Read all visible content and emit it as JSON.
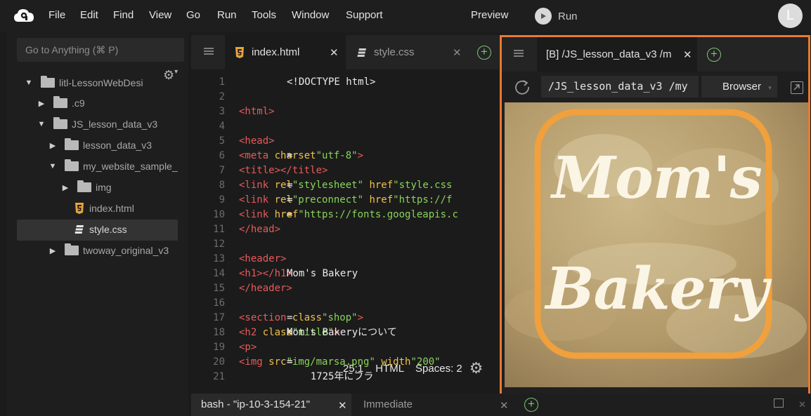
{
  "menubar": {
    "logo_icon": "cloud9-logo-icon",
    "items": [
      "File",
      "Edit",
      "Find",
      "View",
      "Go",
      "Run",
      "Tools",
      "Window",
      "Support"
    ],
    "preview_label": "Preview",
    "run_label": "Run",
    "avatar_initial": "L"
  },
  "sidebar": {
    "goto_placeholder": "Go to Anything (⌘ P)",
    "tree": [
      {
        "label": "litl-LessonWebDesi",
        "type": "folder",
        "expanded": true
      },
      {
        "label": ".c9",
        "type": "folder",
        "expanded": false
      },
      {
        "label": "JS_lesson_data_v3",
        "type": "folder",
        "expanded": true
      },
      {
        "label": "lesson_data_v3",
        "type": "folder",
        "expanded": false
      },
      {
        "label": "my_website_sample_",
        "type": "folder",
        "expanded": true
      },
      {
        "label": "img",
        "type": "folder",
        "expanded": false
      },
      {
        "label": "index.html",
        "type": "html-file"
      },
      {
        "label": "style.css",
        "type": "css-file",
        "selected": true
      },
      {
        "label": "twoway_original_v3",
        "type": "folder",
        "expanded": false
      }
    ]
  },
  "editor": {
    "tabs": [
      {
        "label": "index.html",
        "icon": "html5-icon",
        "active": true
      },
      {
        "label": "style.css",
        "icon": "css3-icon",
        "active": false
      }
    ],
    "lines": [
      [
        {
          "c": "txt",
          "t": "<!DOCTYPE html>"
        }
      ],
      [],
      [
        {
          "c": "tg",
          "t": "<html>"
        }
      ],
      [],
      [
        {
          "c": "tg",
          "t": "<head>"
        }
      ],
      [
        {
          "c": "txt",
          "t": "  "
        },
        {
          "c": "tg",
          "t": "<meta "
        },
        {
          "c": "at",
          "t": "charset"
        },
        {
          "c": "txt",
          "t": "="
        },
        {
          "c": "st",
          "t": "\"utf-8\""
        },
        {
          "c": "tg",
          "t": ">"
        }
      ],
      [
        {
          "c": "txt",
          "t": "  "
        },
        {
          "c": "tg",
          "t": "<title></title>"
        }
      ],
      [
        {
          "c": "txt",
          "t": "  "
        },
        {
          "c": "tg",
          "t": "<link "
        },
        {
          "c": "at",
          "t": "rel"
        },
        {
          "c": "txt",
          "t": "="
        },
        {
          "c": "st",
          "t": "\"stylesheet\" "
        },
        {
          "c": "at",
          "t": "href"
        },
        {
          "c": "txt",
          "t": "="
        },
        {
          "c": "st",
          "t": "\"style.css"
        }
      ],
      [
        {
          "c": "txt",
          "t": "  "
        },
        {
          "c": "tg",
          "t": "<link "
        },
        {
          "c": "at",
          "t": "rel"
        },
        {
          "c": "txt",
          "t": "="
        },
        {
          "c": "st",
          "t": "\"preconnect\" "
        },
        {
          "c": "at",
          "t": "href"
        },
        {
          "c": "txt",
          "t": "="
        },
        {
          "c": "st",
          "t": "\"https://f"
        }
      ],
      [
        {
          "c": "txt",
          "t": "  "
        },
        {
          "c": "tg",
          "t": "<link "
        },
        {
          "c": "at",
          "t": "href"
        },
        {
          "c": "txt",
          "t": "="
        },
        {
          "c": "st",
          "t": "\"https://fonts.googleapis.c"
        }
      ],
      [
        {
          "c": "tg",
          "t": "</head>"
        }
      ],
      [],
      [
        {
          "c": "tg",
          "t": "<header>"
        }
      ],
      [
        {
          "c": "txt",
          "t": "  "
        },
        {
          "c": "tg",
          "t": "<h1>"
        },
        {
          "c": "txt",
          "t": "Mom's Bakery"
        },
        {
          "c": "tg",
          "t": "</h1>"
        }
      ],
      [
        {
          "c": "tg",
          "t": "</header>"
        }
      ],
      [],
      [
        {
          "c": "tg",
          "t": "<section "
        },
        {
          "c": "at",
          "t": "class"
        },
        {
          "c": "txt",
          "t": "="
        },
        {
          "c": "st",
          "t": "\"shop\""
        },
        {
          "c": "tg",
          "t": ">"
        }
      ],
      [
        {
          "c": "txt",
          "t": "  "
        },
        {
          "c": "tg",
          "t": "<h2 "
        },
        {
          "c": "at",
          "t": "class"
        },
        {
          "c": "txt",
          "t": "="
        },
        {
          "c": "st",
          "t": "\"title\""
        },
        {
          "c": "tg",
          "t": ">"
        },
        {
          "c": "txt",
          "t": "Mom's Bakeryについて"
        }
      ],
      [
        {
          "c": "txt",
          "t": "  "
        },
        {
          "c": "tg",
          "t": "<p>"
        }
      ],
      [
        {
          "c": "txt",
          "t": "    "
        },
        {
          "c": "tg",
          "t": "<img "
        },
        {
          "c": "at",
          "t": "src"
        },
        {
          "c": "txt",
          "t": "="
        },
        {
          "c": "st",
          "t": "\"img/marsa.png\" "
        },
        {
          "c": "at",
          "t": "width"
        },
        {
          "c": "txt",
          "t": "="
        },
        {
          "c": "st",
          "t": "\"200\""
        }
      ],
      [
        {
          "c": "txt",
          "t": "    1725年にフラ"
        }
      ]
    ],
    "status": {
      "position": "25:1",
      "mode": "HTML",
      "indent": "Spaces: 2"
    }
  },
  "preview": {
    "tab_label": "[B] /JS_lesson_data_v3 /m",
    "url": "/JS_lesson_data_v3 /my",
    "browser_label": "Browser",
    "page_heading_line1": "Mom's",
    "page_heading_line2": "Bakery",
    "frame_color": "#e8792f",
    "badge_color": "#f0a03c"
  },
  "terminal": {
    "tabs": [
      {
        "label": "bash - \"ip-10-3-154-21\"",
        "active": true
      },
      {
        "label": "Immediate",
        "active": false
      }
    ]
  }
}
